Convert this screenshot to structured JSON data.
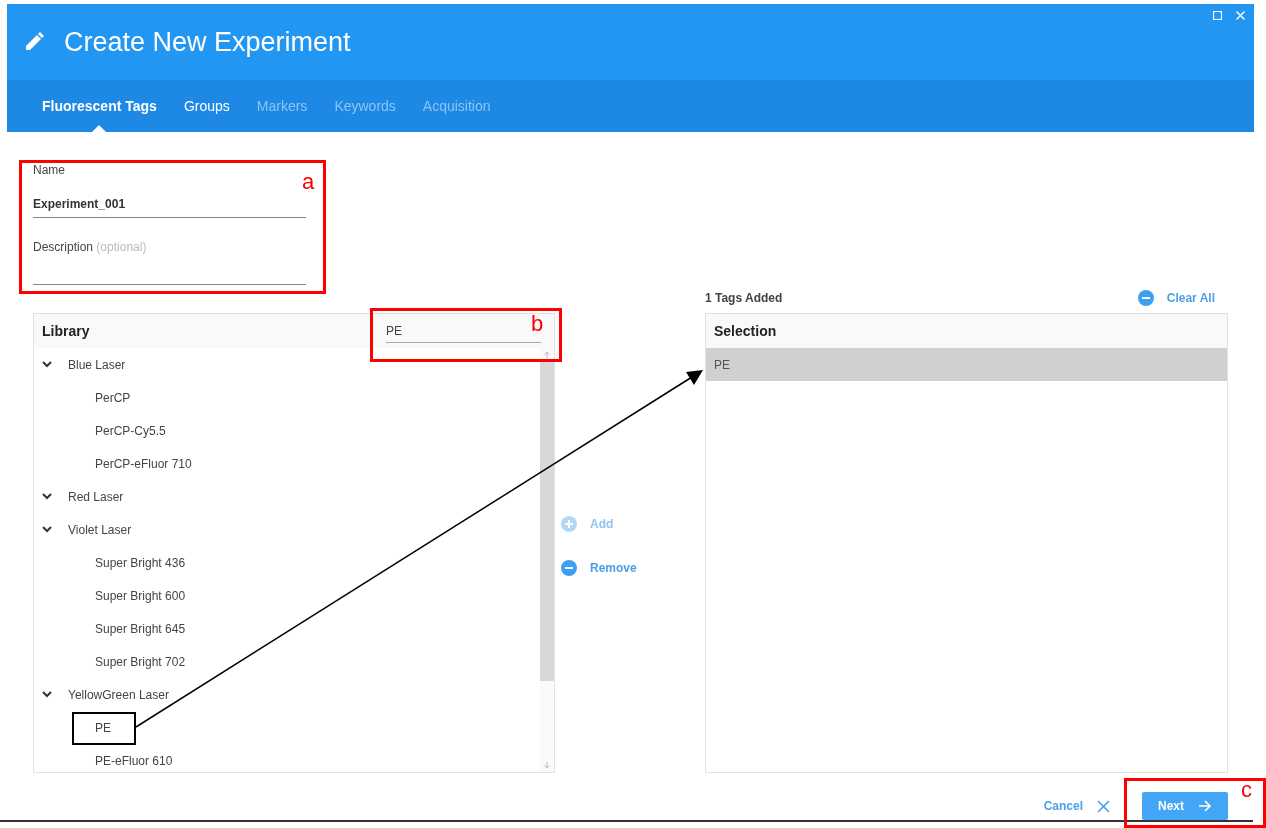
{
  "window": {
    "title": "Create New Experiment"
  },
  "tabs": [
    {
      "label": "Fluorescent Tags",
      "selected": true,
      "disabled": false
    },
    {
      "label": "Groups",
      "selected": false,
      "disabled": false
    },
    {
      "label": "Markers",
      "selected": false,
      "disabled": true
    },
    {
      "label": "Keywords",
      "selected": false,
      "disabled": true
    },
    {
      "label": "Acquisition",
      "selected": false,
      "disabled": true
    }
  ],
  "form": {
    "name_label": "Name",
    "name_value": "Experiment_001",
    "description_label": "Description",
    "description_hint": "(optional)"
  },
  "library": {
    "title": "Library",
    "search": {
      "value": "PE"
    },
    "tree": [
      {
        "label": "Blue Laser",
        "expanded": true,
        "children": [
          {
            "label": "PerCP"
          },
          {
            "label": "PerCP-Cy5.5"
          },
          {
            "label": "PerCP-eFluor 710"
          }
        ]
      },
      {
        "label": "Red Laser",
        "expanded": true
      },
      {
        "label": "Violet Laser",
        "expanded": true,
        "children": [
          {
            "label": "Super Bright 436"
          },
          {
            "label": "Super Bright 600"
          },
          {
            "label": "Super Bright 645"
          },
          {
            "label": "Super Bright 702"
          }
        ]
      },
      {
        "label": "YellowGreen Laser",
        "expanded": true,
        "children": [
          {
            "label": "PE"
          },
          {
            "label": "PE-eFluor 610"
          }
        ]
      }
    ]
  },
  "actions": [
    {
      "label": "Add",
      "kind": "add",
      "disabled": true
    },
    {
      "label": "Remove",
      "kind": "remove",
      "disabled": false
    }
  ],
  "selection": {
    "count_text": "1 Tags Added",
    "clear_all": "Clear All",
    "title": "Selection",
    "items": [
      {
        "label": "PE",
        "selected": true
      }
    ]
  },
  "footer": {
    "cancel": "Cancel",
    "next": "Next"
  },
  "annotations": [
    {
      "kind": "red-box",
      "label": "a"
    },
    {
      "kind": "red-box",
      "label": "b"
    },
    {
      "kind": "red-box",
      "label": "c"
    },
    {
      "kind": "black-box"
    },
    {
      "kind": "arrow"
    }
  ]
}
